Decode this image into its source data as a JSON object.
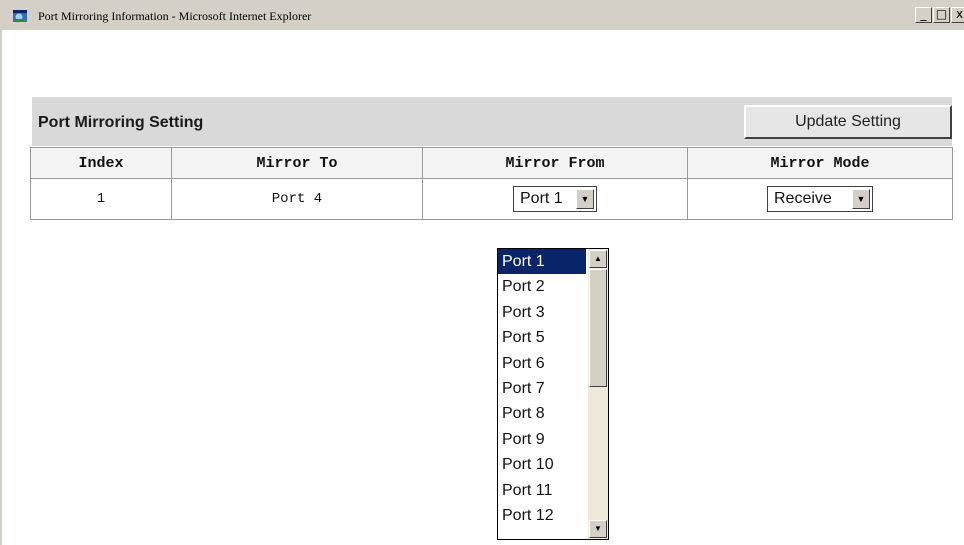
{
  "window": {
    "title": "Port Mirroring Information - Microsoft Internet Explorer",
    "minimize_glyph": "_",
    "maximize_glyph": "□",
    "close_glyph": "x"
  },
  "setting_bar": {
    "title": "Port Mirroring Setting",
    "update_button": "Update Setting"
  },
  "table": {
    "headers": [
      "Index",
      "Mirror To",
      "Mirror From",
      "Mirror Mode"
    ],
    "rows": [
      {
        "index": "1",
        "mirror_to": "Port 4",
        "mirror_from": "Port 1",
        "mirror_mode": "Receive"
      }
    ]
  },
  "mirror_from_dropdown": {
    "options": [
      "Port 1",
      "Port 2",
      "Port 3",
      "Port 5",
      "Port 6",
      "Port 7",
      "Port 8",
      "Port 9",
      "Port 10",
      "Port 11",
      "Port 12"
    ],
    "selected": "Port 1"
  },
  "colors": {
    "selection": "#0a246a",
    "bar_background": "#d9d9d9",
    "chrome": "#d4d0c8"
  },
  "icons": {
    "window": "ie-icon",
    "dropdown": "chevron-down-icon",
    "scroll_up": "scroll-up-icon",
    "scroll_down": "scroll-down-icon"
  }
}
